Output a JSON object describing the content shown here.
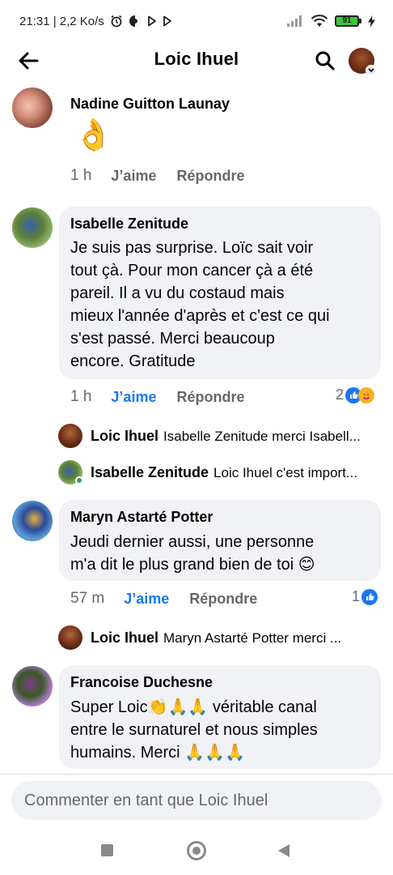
{
  "status_bar": {
    "time_speed": "21:31 | 2,2 Ko/s",
    "battery": "91",
    "icons": [
      "alarm-icon",
      "dark-app-icon",
      "play-icon",
      "play-icon",
      "signal-icon",
      "wifi-icon",
      "battery-icon",
      "charging-icon"
    ]
  },
  "header": {
    "title": "Loic Ihuel",
    "icons": [
      "back-arrow-icon",
      "search-icon",
      "profile-avatar"
    ]
  },
  "comments": [
    {
      "author": "Nadine Guitton Launay",
      "emoji": "👌",
      "time": "1 h",
      "like": "J’aime",
      "reply": "Répondre"
    },
    {
      "author": "Isabelle Zenitude",
      "lines": [
        "Je suis pas surprise. Loïc sait voir",
        "tout çà. Pour mon cancer çà a été",
        "pareil. Il a vu du costaud mais",
        "mieux l'année d'après et c'est ce qui",
        "s'est passé. Merci beaucoup",
        "encore. Gratitude"
      ],
      "time": "1 h",
      "like": "J’aime",
      "reply": "Répondre",
      "reaction_count": "2",
      "replies": [
        {
          "name": "Loic Ihuel",
          "text": "Isabelle Zenitude merci Isabell..."
        },
        {
          "name": "Isabelle Zenitude",
          "text": "Loic Ihuel c'est import..."
        }
      ]
    },
    {
      "author": "Maryn Astarté Potter",
      "lines": [
        "Jeudi dernier aussi, une personne",
        "m'a dit le plus grand bien de toi 😊"
      ],
      "time": "57 m",
      "like": "J’aime",
      "reply": "Répondre",
      "reaction_count": "1",
      "replies": [
        {
          "name": "Loic Ihuel",
          "text": "Maryn Astarté Potter merci ..."
        }
      ]
    },
    {
      "author": "Francoise Duchesne",
      "lines": [
        "Super Loic👏🙏🙏 véritable canal",
        "entre le surnaturel et nous simples",
        "humains. Merci 🙏🙏🙏"
      ]
    }
  ],
  "composer": {
    "placeholder": "Commenter en tant que Loic Ihuel"
  },
  "colors": {
    "accent": "#1877f2",
    "bubble": "#f0f2f5",
    "secondary_text": "#65676b",
    "online": "#31a24c"
  }
}
